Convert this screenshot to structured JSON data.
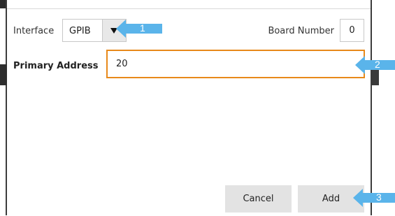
{
  "dialog": {
    "interface_label": "Interface",
    "interface_value": "GPIB",
    "board_number_label": "Board Number",
    "board_number_value": "0",
    "primary_address_label": "Primary Address",
    "primary_address_value": "20",
    "cancel_label": "Cancel",
    "add_label": "Add"
  },
  "callouts": [
    {
      "number": "1",
      "icon": "arrow-left-callout"
    },
    {
      "number": "2",
      "icon": "arrow-left-callout"
    },
    {
      "number": "3",
      "icon": "arrow-left-callout"
    }
  ],
  "colors": {
    "accent_orange": "#e8891a",
    "callout_blue": "#5ab4ea",
    "button_gray": "#e3e3e3"
  }
}
